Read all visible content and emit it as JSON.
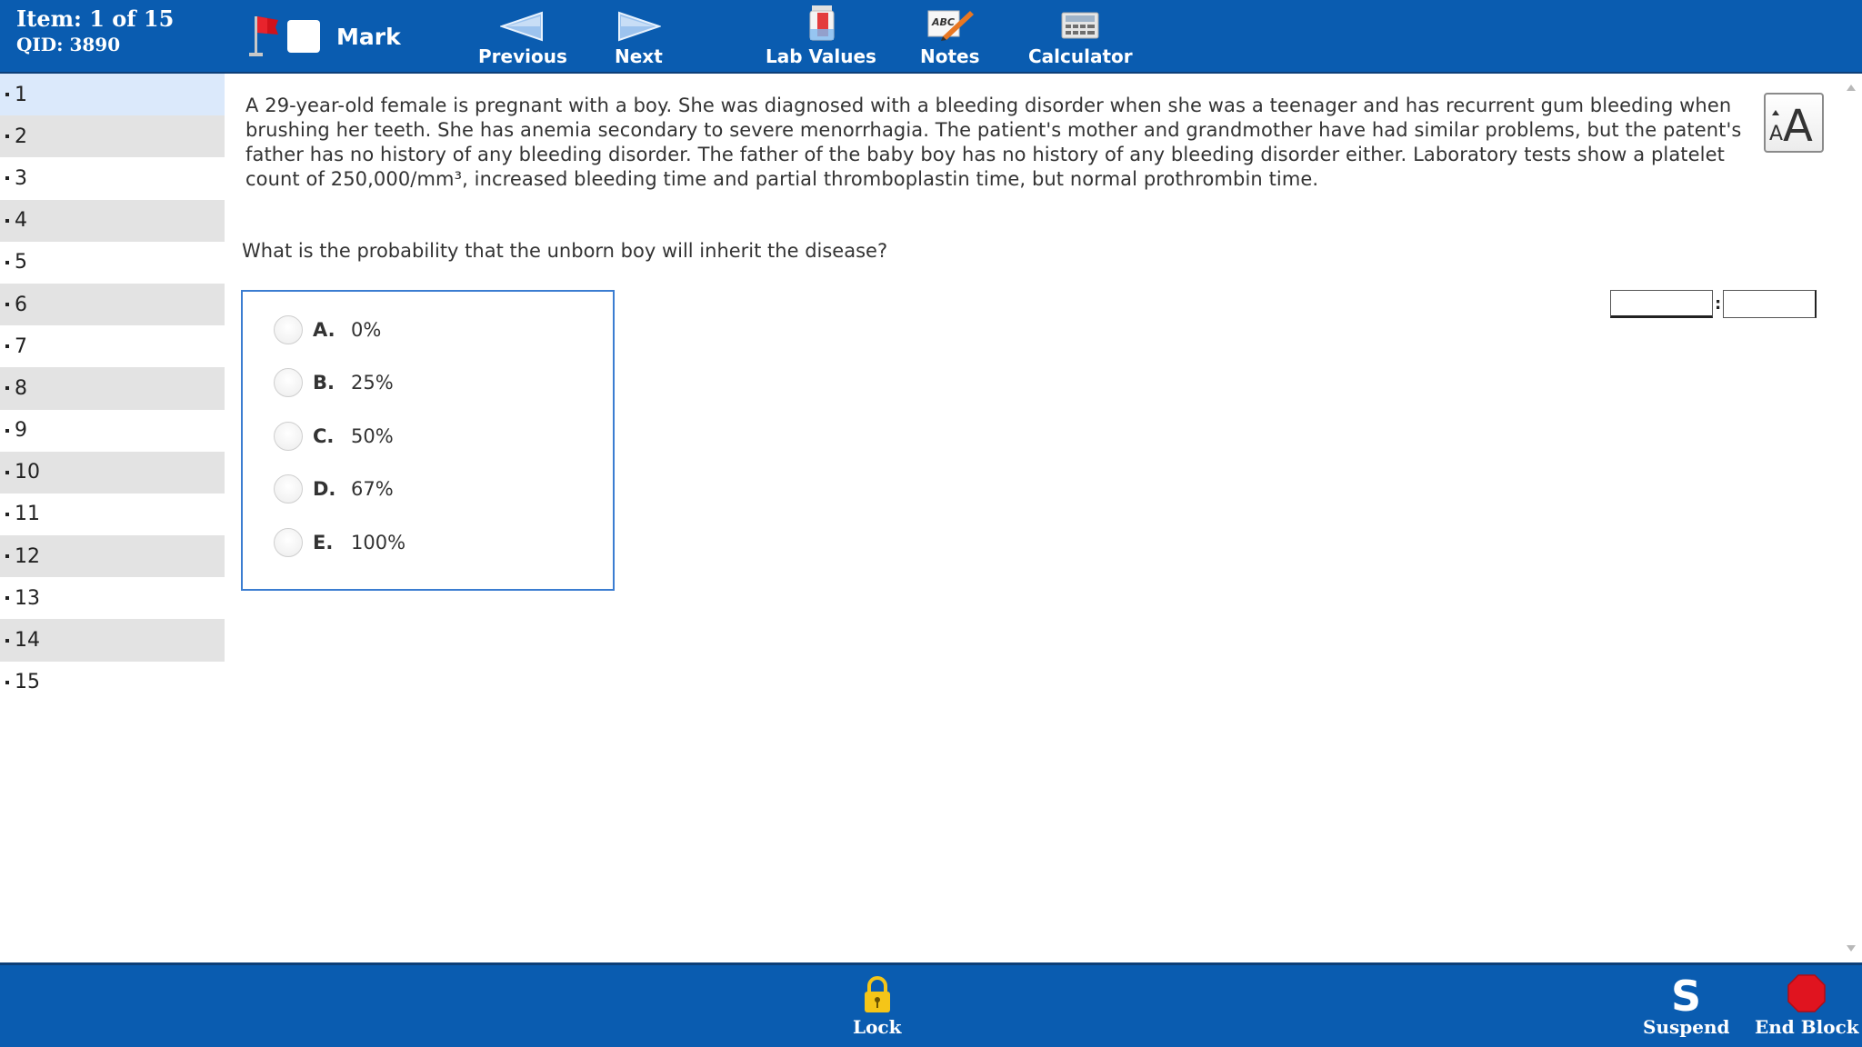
{
  "header": {
    "item_label": "Item: 1 of 15",
    "qid_label": "QID: 3890",
    "mark_label": "Mark",
    "previous_label": "Previous",
    "next_label": "Next",
    "lab_values_label": "Lab Values",
    "notes_label": "Notes",
    "calculator_label": "Calculator"
  },
  "sidebar": {
    "items": [
      {
        "label": "1"
      },
      {
        "label": "2"
      },
      {
        "label": "3"
      },
      {
        "label": "4"
      },
      {
        "label": "5"
      },
      {
        "label": "6"
      },
      {
        "label": "7"
      },
      {
        "label": "8"
      },
      {
        "label": "9"
      },
      {
        "label": "10"
      },
      {
        "label": "11"
      },
      {
        "label": "12"
      },
      {
        "label": "13"
      },
      {
        "label": "14"
      },
      {
        "label": "15"
      }
    ]
  },
  "question": {
    "stem": "A 29-year-old female is pregnant with a boy. She was diagnosed with a bleeding disorder when she was a teenager and has recurrent gum bleeding when brushing her teeth. She has anemia secondary to severe menorrhagia. The patient's mother and grandmother have had similar problems, but the patent's father has no history of any bleeding disorder. The father of the baby boy has no history of any bleeding disorder either. Laboratory tests show a platelet count of 250,000/mm³, increased bleeding time and partial thromboplastin time, but normal prothrombin time.",
    "prompt": "What is the probability that the unborn boy will inherit the disease?",
    "answers": [
      {
        "letter": "A.",
        "text": "0%"
      },
      {
        "letter": "B.",
        "text": "25%"
      },
      {
        "letter": "C.",
        "text": "50%"
      },
      {
        "letter": "D.",
        "text": "67%"
      },
      {
        "letter": "E.",
        "text": "100%"
      }
    ]
  },
  "footer": {
    "lock_label": "Lock",
    "suspend_label": "Suspend",
    "end_block_label": "End Block"
  },
  "colors": {
    "toolbar": "#0a5cb0",
    "current_item": "#dbe9fb",
    "alt_row": "#e3e3e3",
    "answer_border": "#3b7dd1",
    "flag_red": "#d0121b",
    "stop_red": "#e0141f",
    "lock_yellow": "#f5c518"
  }
}
